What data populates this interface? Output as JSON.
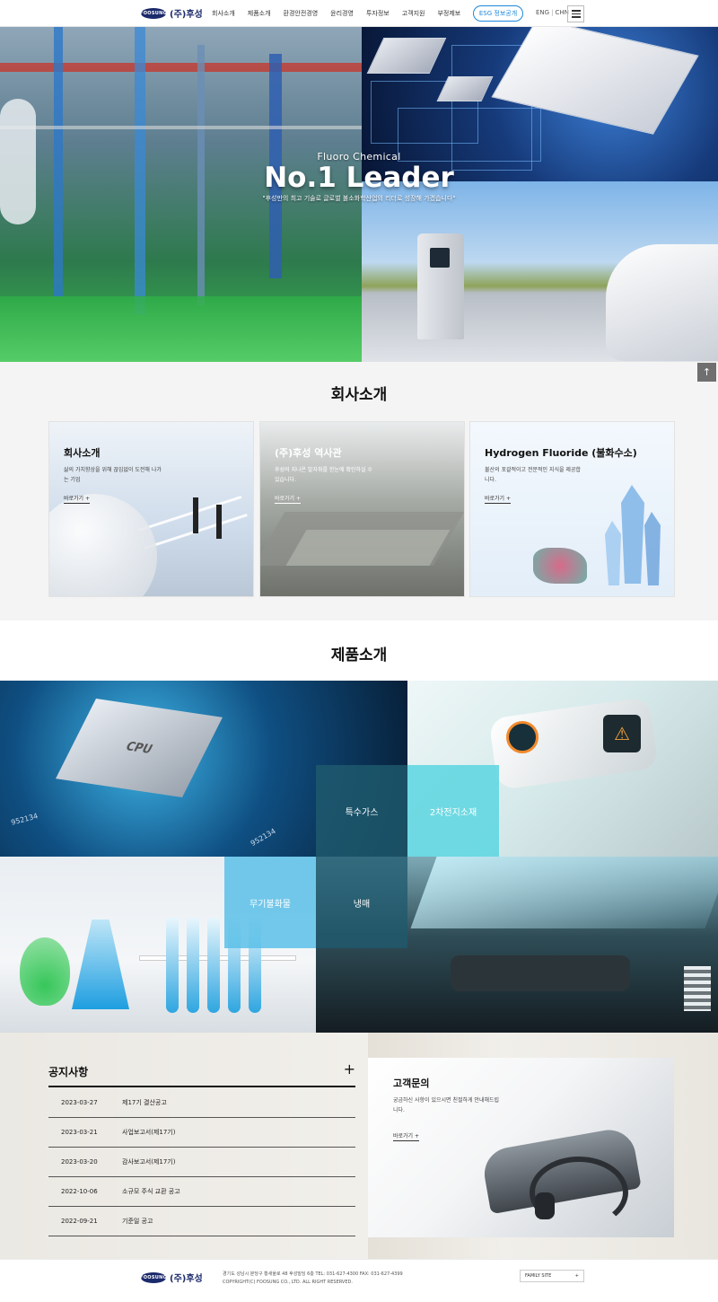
{
  "header": {
    "logo_mark": "FOOSUNG",
    "logo_text": "(주)후성",
    "nav": [
      "회사소개",
      "제품소개",
      "환경안전경영",
      "윤리경영",
      "투자정보",
      "고객지원",
      "부정제보"
    ],
    "esg_button": "ESG 정보공개",
    "lang": [
      "ENG",
      "CHN"
    ],
    "menu_icon": "hamburger-icon"
  },
  "hero": {
    "subtitle": "Fluoro Chemical",
    "title": "No.1 Leader",
    "description": "\"후성만의 최고 기술로 글로벌 불소화학산업의 리더로 성장해 가겠습니다\""
  },
  "top_button": "↑",
  "company": {
    "title": "회사소개",
    "cards": [
      {
        "title": "회사소개",
        "desc": "삶의 가치향상을 위해 끊임없이 도전해 나가는 기업",
        "link": "바로가기 +"
      },
      {
        "title": "(주)후성 역사관",
        "desc": "후성의 지나온 발자취를 한눈에 확인하실 수 있습니다.",
        "link": "바로가기 +"
      },
      {
        "title": "Hydrogen Fluoride (불화수소)",
        "desc": "불산의 포괄적이고 전문적인 지식을 제공합니다.",
        "link": "바로가기 +"
      }
    ]
  },
  "products": {
    "title": "제품소개",
    "tiles": [
      "특수가스",
      "2차전지소재",
      "무기불화물",
      "냉매"
    ],
    "chip_labels": [
      "CPU",
      "952134",
      "952134"
    ]
  },
  "notice": {
    "title": "공지사항",
    "plus": "+",
    "items": [
      {
        "date": "2023-03-27",
        "text": "제17기 결산공고"
      },
      {
        "date": "2023-03-21",
        "text": "사업보고서(제17기)"
      },
      {
        "date": "2023-03-20",
        "text": "감사보고서(제17기)"
      },
      {
        "date": "2022-10-06",
        "text": "소규모 주식 교환 공고"
      },
      {
        "date": "2022-09-21",
        "text": "기준일 공고"
      }
    ]
  },
  "contact": {
    "title": "고객문의",
    "desc": "궁금하신 사항이 있으시면 친절하게 안내해드립니다.",
    "link": "바로가기 +"
  },
  "footer": {
    "logo_mark": "FOOSUNG",
    "logo_text": "(주)후성",
    "address": "경기도 성남시 분당구 황새울로 48 후성빌딩 6층 TEL: 031-627-4300 FAX: 031-627-4399",
    "copyright": "COPYRIGHT(C) FOOSUNG CO., LTD. ALL RIGHT RESERVED.",
    "family_site": "FAMILY SITE",
    "family_plus": "+"
  },
  "colors": {
    "brand_navy": "#1b2a6b",
    "esg_blue": "#1e88d8",
    "tile_cyan": "#5fd6e0",
    "tile_sky": "#5bbfe8",
    "tile_dark_teal": "#1f5a6e"
  }
}
